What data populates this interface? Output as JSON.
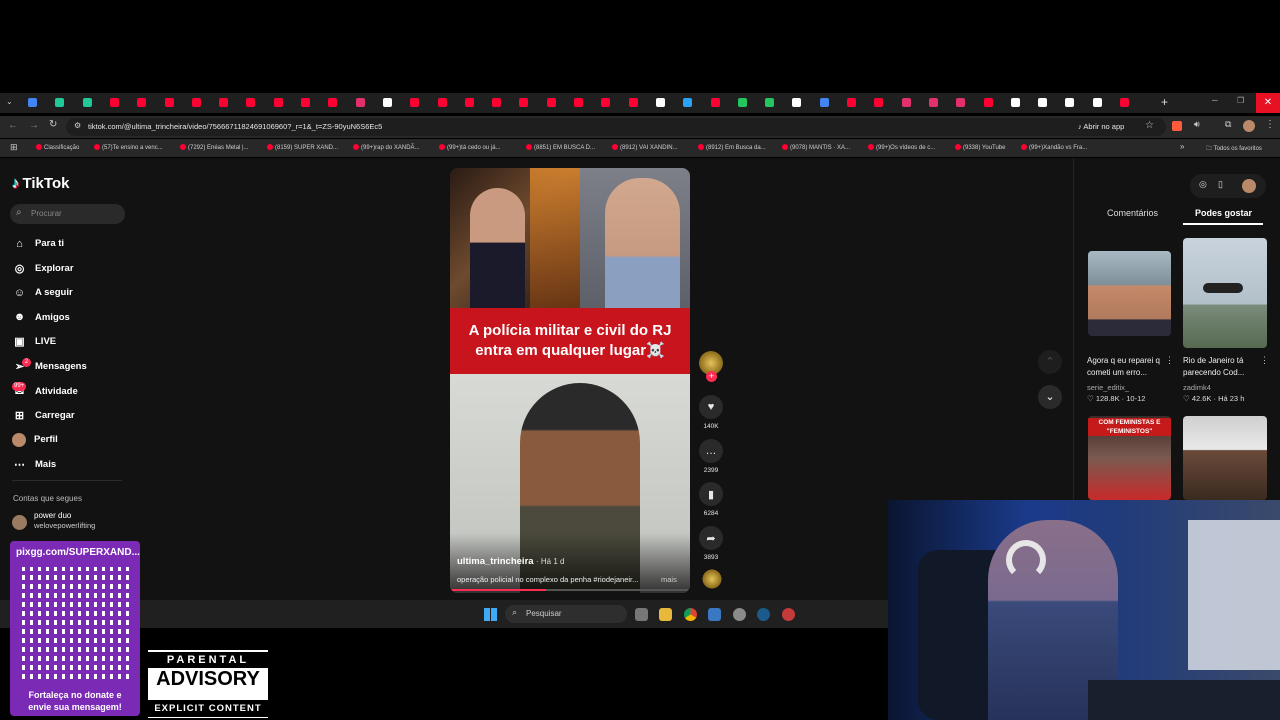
{
  "browser": {
    "url": "tiktok.com/@ultima_trincheira/video/7566671182469106960?_r=1&_t=ZS-90yuN6S6Ec5",
    "open_in_app": "Abrir no app",
    "bookmarks": [
      "Classificação",
      "(57)Te ensino a venc...",
      "(7292) Enéas Metal |...",
      "(8159) SUPER XAND...",
      "(99+)rap do XANDÃ...",
      "(99+)tá cedo ou já...",
      "(8851) EM BUSCA D...",
      "(8912) VAI XANDIN...",
      "(8912) Em Busca da...",
      "(9078) MANTIS · XA...",
      "(99+)Os vídeos de c...",
      "(9338) YouTube",
      "(99+)Xandão vs Fra..."
    ],
    "all_favorites": "Todos os favoritos"
  },
  "tiktok": {
    "logo": "TikTok",
    "search_placeholder": "Procurar",
    "nav": [
      {
        "label": "Para ti",
        "icon": "home-icon"
      },
      {
        "label": "Explorar",
        "icon": "compass-icon"
      },
      {
        "label": "A seguir",
        "icon": "user-plus-icon"
      },
      {
        "label": "Amigos",
        "icon": "friends-icon"
      },
      {
        "label": "LIVE",
        "icon": "live-icon"
      },
      {
        "label": "Mensagens",
        "icon": "send-icon"
      },
      {
        "label": "Atividade",
        "icon": "inbox-icon"
      },
      {
        "label": "Carregar",
        "icon": "upload-icon"
      },
      {
        "label": "Perfil",
        "icon": "profile-icon"
      },
      {
        "label": "Mais",
        "icon": "more-icon"
      }
    ],
    "messages_badge": "2",
    "activity_badge": "99+",
    "following_title": "Contas que segues",
    "following_account": {
      "name": "power duo",
      "handle": "welovepowerlifting"
    },
    "video": {
      "caption_line1": "A polícia militar e civil do RJ",
      "caption_line2": "entra em qualquer lugar☠️",
      "author": "ultima_trincheira",
      "time": "· Há 1 d",
      "description": "operação policial no complexo da penha #riodejaneir...",
      "more": "mais"
    },
    "actions": {
      "likes": "140K",
      "comments": "2399",
      "saves": "6284",
      "shares": "3893"
    },
    "right_tabs": {
      "comments": "Comentários",
      "recommended": "Podes gostar"
    },
    "recommended": [
      {
        "caption": "Agora q eu reparei q cometi um erro...",
        "user": "serie_editix_",
        "likes": "128.8K",
        "date": "10-12"
      },
      {
        "caption": "Rio de Janeiro tá parecendo Cod...",
        "user": "zadimk4",
        "likes": "42.6K",
        "date": "Há 23 h"
      },
      {
        "caption": "COM FEMINISTAS E \"FEMINISTOS\""
      }
    ]
  },
  "taskbar": {
    "search": "Pesquisar"
  },
  "overlay": {
    "donate_url": "pixgg.com/SUPERXAND...",
    "donate_text": "Fortaleça no donate e envie sua mensagem!",
    "advisory_top": "PARENTAL",
    "advisory_mid": "ADVISORY",
    "advisory_bottom": "EXPLICIT CONTENT"
  }
}
